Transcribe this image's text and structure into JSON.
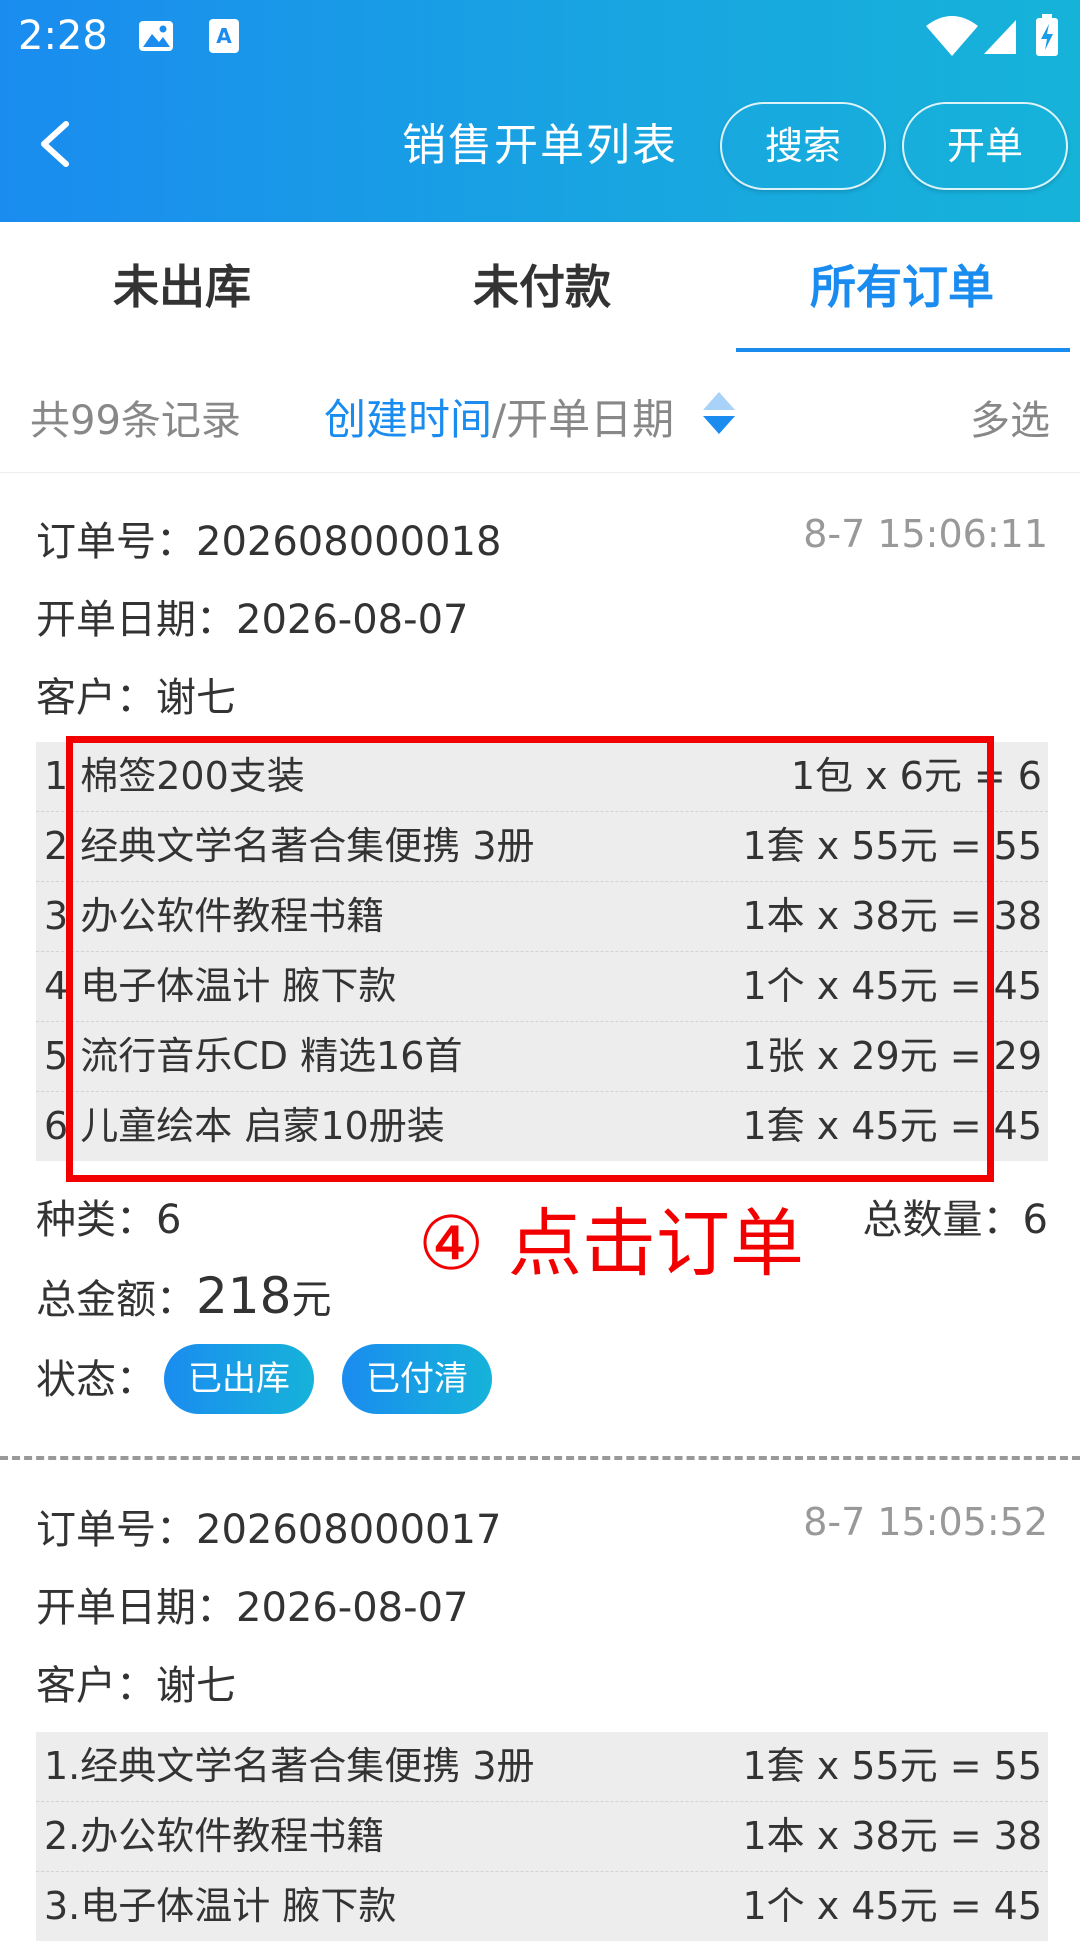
{
  "status_bar": {
    "time": "2:28"
  },
  "header": {
    "title": "销售开单列表",
    "search_label": "搜索",
    "new_order_label": "开单"
  },
  "tabs": [
    {
      "label": "未出库",
      "active": false
    },
    {
      "label": "未付款",
      "active": false
    },
    {
      "label": "所有订单",
      "active": true
    }
  ],
  "filter": {
    "count_text": "共99条记录",
    "sort_active": "创建时间",
    "sort_inactive": "/开单日期",
    "multi_select": "多选"
  },
  "labels": {
    "order_no": "订单号：",
    "order_date": "开单日期：",
    "customer": "客户：",
    "kinds": "种类：",
    "total_qty": "总数量：",
    "total_amount": "总金额：",
    "status": "状态："
  },
  "orders": [
    {
      "order_no": "202608000018",
      "time": "8-7 15:06:11",
      "date": "2026-08-07",
      "customer": "谢七",
      "items": [
        {
          "name": "1 棉签200支装",
          "calc": "1包 x 6元 = 6"
        },
        {
          "name": "2 经典文学名著合集便携 3册",
          "calc": "1套 x 55元 = 55"
        },
        {
          "name": "3 办公软件教程书籍",
          "calc": "1本 x 38元 = 38"
        },
        {
          "name": "4 电子体温计 腋下款",
          "calc": "1个 x 45元 = 45"
        },
        {
          "name": "5 流行音乐CD 精选16首",
          "calc": "1张 x 29元 = 29"
        },
        {
          "name": "6 儿童绘本 启蒙10册装",
          "calc": "1套 x 45元 = 45"
        }
      ],
      "kinds": "6",
      "total_qty": "6",
      "total_amount": "218",
      "amount_unit": "元",
      "status_badges": [
        "已出库",
        "已付清"
      ]
    },
    {
      "order_no": "202608000017",
      "time": "8-7 15:05:52",
      "date": "2026-08-07",
      "customer": "谢七",
      "items": [
        {
          "name": "1.经典文学名著合集便携 3册",
          "calc": "1套 x 55元 = 55"
        },
        {
          "name": "2.办公软件教程书籍",
          "calc": "1本 x 38元 = 38"
        },
        {
          "name": "3.电子体温计 腋下款",
          "calc": "1个 x 45元 = 45"
        }
      ]
    }
  ],
  "annotation": {
    "text": "④ 点击订单",
    "color": "#f20000"
  },
  "colors": {
    "accent": "#1a8cf0",
    "header_gradient_end": "#16b3d9"
  }
}
